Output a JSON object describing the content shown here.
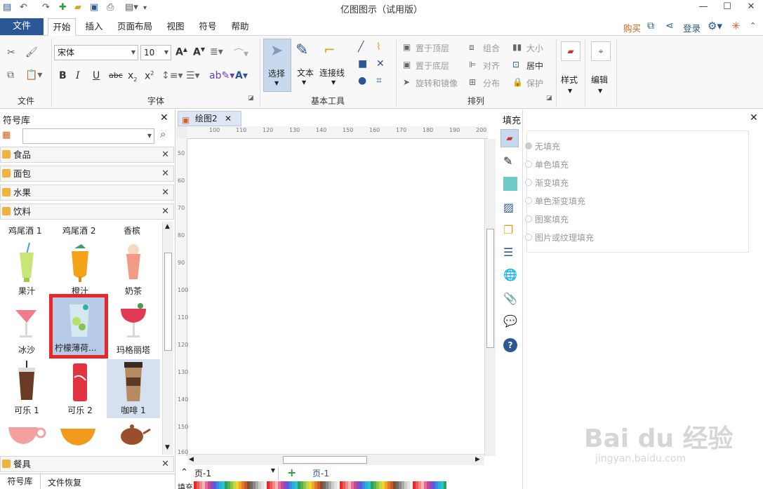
{
  "window": {
    "title": "亿图图示（试用版）"
  },
  "menu": {
    "file": "文件",
    "tabs": [
      "开始",
      "插入",
      "页面布局",
      "视图",
      "符号",
      "帮助"
    ],
    "right": {
      "buy": "购买",
      "login": "登录"
    }
  },
  "ribbon": {
    "file_group": {
      "label": "文件"
    },
    "font_group": {
      "label": "字体",
      "font_name": "宋体",
      "font_size": "10"
    },
    "basic_tools": {
      "label": "基本工具",
      "select": "选择",
      "text": "文本",
      "connector": "连接线"
    },
    "arrange": {
      "label": "排列",
      "bring_top": "置于顶层",
      "send_bottom": "置于底层",
      "rotate": "旋转和镜像",
      "group": "组合",
      "align": "对齐",
      "distribute": "分布",
      "size": "大小",
      "center": "居中",
      "protect": "保护"
    },
    "style": "样式",
    "edit": "编辑"
  },
  "library": {
    "title": "符号库",
    "search_placeholder": "",
    "categories": [
      "食品",
      "面包",
      "水果",
      "饮料"
    ],
    "bottom_category": "餐具",
    "symbols": {
      "row0": [
        "鸡尾酒 1",
        "鸡尾酒 2",
        "香槟"
      ],
      "row1": [
        "果汁",
        "橙汁",
        "奶茶"
      ],
      "row2": [
        "冰沙",
        "柠檬薄荷...",
        "玛格丽塔"
      ],
      "row3": [
        "可乐 1",
        "可乐 2",
        "咖啡 1"
      ]
    },
    "bottom_tabs": [
      "符号库",
      "文件恢复"
    ]
  },
  "document": {
    "tab": "绘图2",
    "ruler_h": [
      "100",
      "110",
      "120",
      "130",
      "140",
      "150",
      "160",
      "170",
      "180",
      "190",
      "200"
    ],
    "ruler_v": [
      "50",
      "60",
      "70",
      "80",
      "90",
      "100",
      "110",
      "120",
      "130",
      "140",
      "150",
      "160"
    ]
  },
  "fill_panel": {
    "title": "填充",
    "options": [
      "无填充",
      "单色填充",
      "渐变填充",
      "单色渐变填充",
      "图案填充",
      "图片或纹理填充"
    ]
  },
  "status": {
    "page_select": "页-1",
    "page_tab": "页-1",
    "fill_label": "填充"
  },
  "watermark": {
    "brand": "Bai du 经验",
    "url": "jingyan.baidu.com"
  },
  "colors": {
    "accent": "#2b5797",
    "highlight": "#e8272a",
    "selected": "#b8cbe6"
  }
}
